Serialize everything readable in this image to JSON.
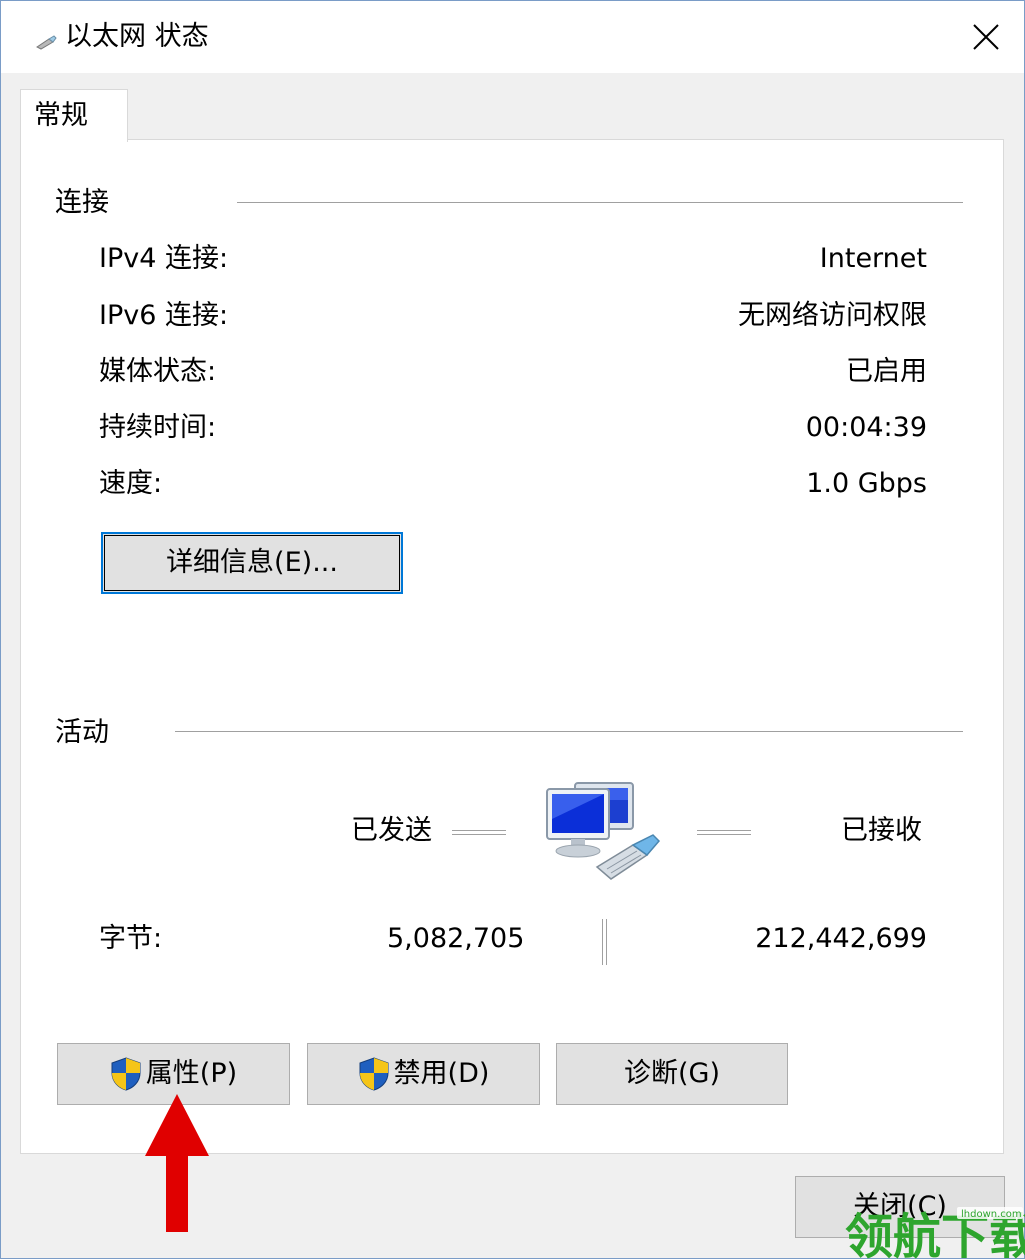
{
  "window": {
    "title": "以太网 状态",
    "title_icon": "ethernet-connector-icon",
    "close_icon": "close-icon"
  },
  "tabs": [
    {
      "label": "常规",
      "selected": true
    }
  ],
  "connection": {
    "group_label": "连接",
    "rows": [
      {
        "label": "IPv4 连接:",
        "value": "Internet"
      },
      {
        "label": "IPv6 连接:",
        "value": "无网络访问权限"
      },
      {
        "label": "媒体状态:",
        "value": "已启用"
      },
      {
        "label": "持续时间:",
        "value": "00:04:39"
      },
      {
        "label": "速度:",
        "value": "1.0 Gbps"
      }
    ],
    "details_button": "详细信息(E)...",
    "details_button_accel": "E"
  },
  "activity": {
    "group_label": "活动",
    "sent_label": "已发送",
    "received_label": "已接收",
    "network_icon": "network-computers-icon",
    "bytes_label": "字节:",
    "bytes_sent": "5,082,705",
    "bytes_received": "212,442,699"
  },
  "buttons": {
    "properties": "属性(P)",
    "disable": "禁用(D)",
    "diagnose": "诊断(G)",
    "close": "关闭(C)",
    "shield_icon": "uac-shield-icon"
  },
  "annotation": {
    "arrow_icon": "red-up-arrow-icon",
    "arrow_color": "#e00000"
  },
  "watermark": {
    "text": "领航下载",
    "site": "lhdown.com",
    "color": "#2ea52e"
  },
  "colors": {
    "focus_border": "#0078d7",
    "button_face": "#e1e1e1"
  }
}
